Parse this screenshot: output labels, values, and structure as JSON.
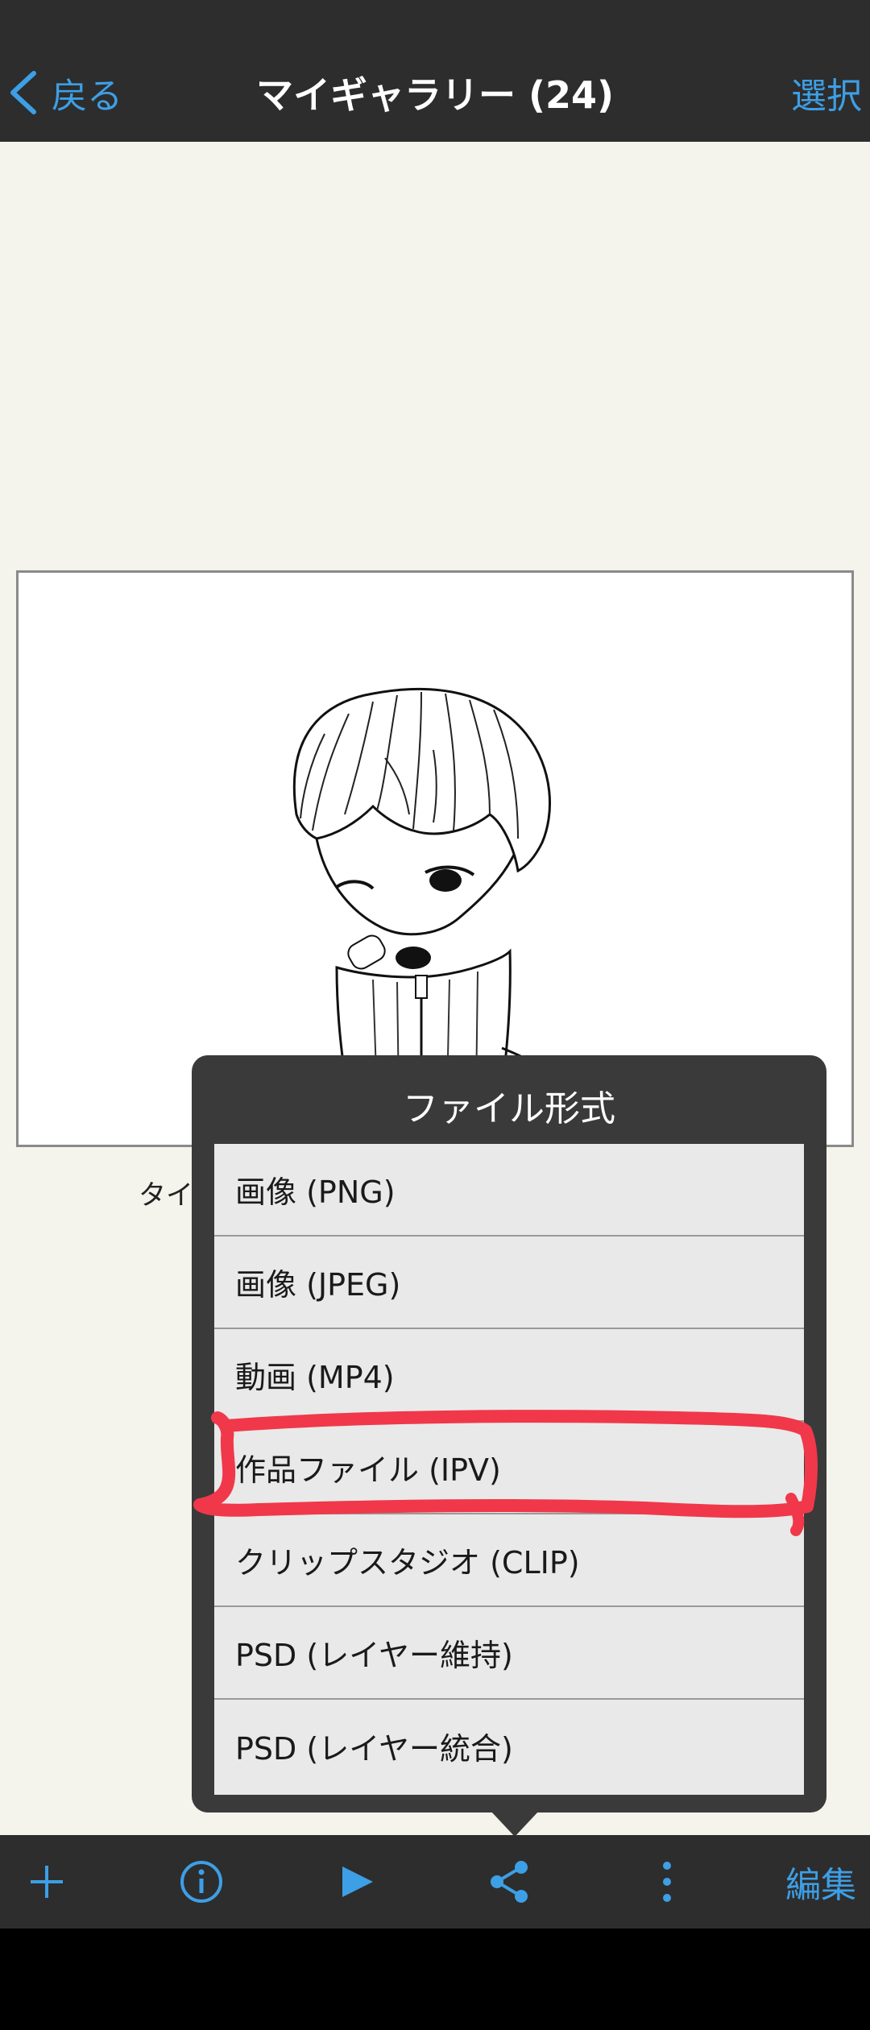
{
  "navbar": {
    "back_label": "戻る",
    "title": "マイギャラリー (24)",
    "select_label": "選択"
  },
  "gallery": {
    "title_label": "タイト"
  },
  "popover": {
    "title": "ファイル形式",
    "items": [
      {
        "label": "画像 (PNG)"
      },
      {
        "label": "画像 (JPEG)"
      },
      {
        "label": "動画 (MP4)"
      },
      {
        "label": "作品ファイル (IPV)"
      },
      {
        "label": "クリップスタジオ (CLIP)"
      },
      {
        "label": "PSD (レイヤー維持)"
      },
      {
        "label": "PSD (レイヤー統合)"
      }
    ],
    "highlighted_index": 3
  },
  "toolbar": {
    "icons": [
      "plus-icon",
      "info-icon",
      "play-icon",
      "share-icon",
      "more-vertical-icon"
    ],
    "edit_label": "編集"
  },
  "colors": {
    "accent": "#3d9fe6",
    "bar": "#2d2d2d",
    "highlight": "#f0384a"
  }
}
